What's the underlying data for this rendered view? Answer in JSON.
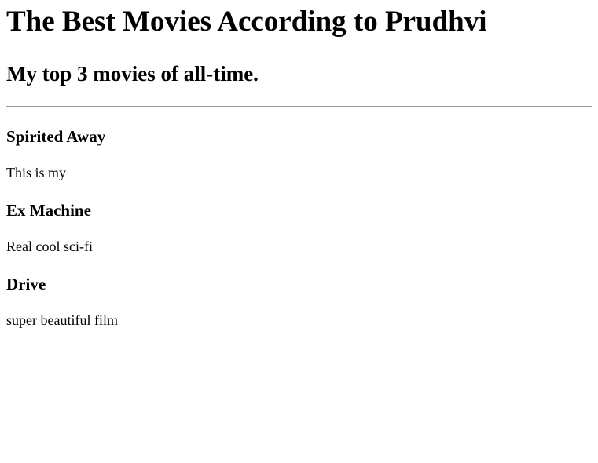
{
  "header": {
    "title": "The Best Movies According to Prudhvi",
    "subtitle": "My top 3 movies of all-time."
  },
  "movies": [
    {
      "title": "Spirited Away",
      "description": "This is my"
    },
    {
      "title": "Ex Machine",
      "description": "Real cool sci-fi"
    },
    {
      "title": "Drive",
      "description": "super beautiful film"
    }
  ]
}
